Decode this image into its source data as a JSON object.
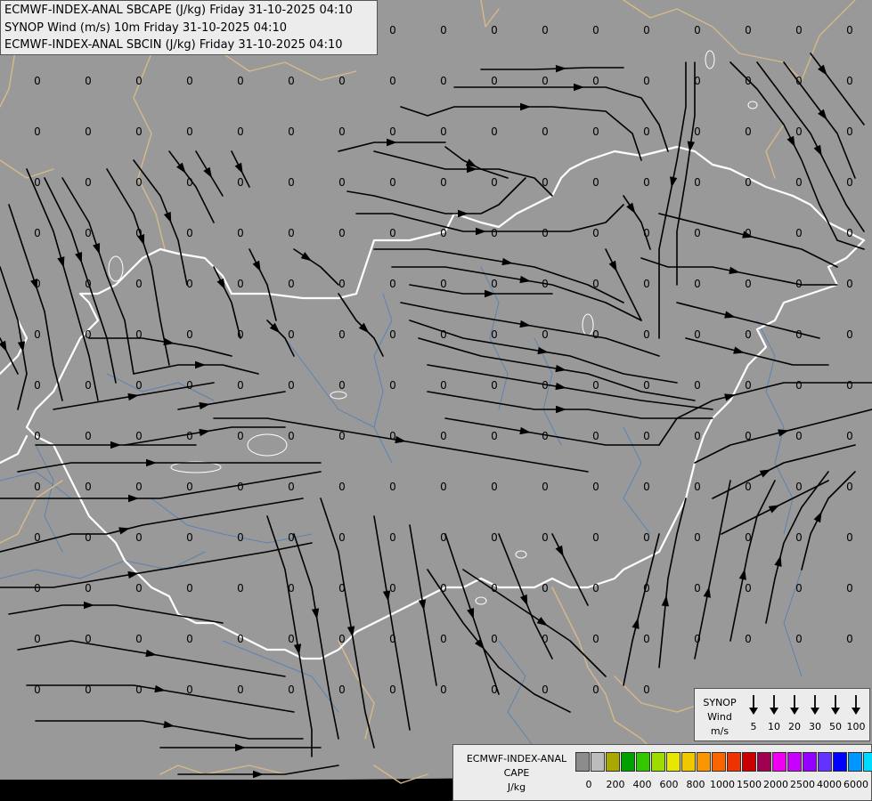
{
  "header": {
    "line1": "ECMWF-INDEX-ANAL SBCAPE (J/kg) Friday 31-10-2025 04:10",
    "line2": "SYNOP Wind (m/s) 10m Friday 31-10-2025 04:10",
    "line3": "ECMWF-INDEX-ANAL SBCIN (J/kg) Friday 31-10-2025 04:10"
  },
  "map": {
    "value_label": "0",
    "colors": {
      "background": "#999999",
      "border_national": "#ffffff",
      "border_regional": "#d6b989",
      "river": "#5c83b0",
      "streamline": "#000000"
    }
  },
  "synop_legend": {
    "title_line1": "SYNOP",
    "title_line2": "Wind",
    "title_line3": "m/s",
    "values": [
      "5",
      "10",
      "20",
      "30",
      "50",
      "100"
    ]
  },
  "cape_legend": {
    "title_line1": "ECMWF-INDEX-ANAL",
    "title_line2": "CAPE",
    "title_line3": "J/kg",
    "swatch_colors": [
      "#8c8c8c",
      "#bcbcbc",
      "#a8a800",
      "#00a000",
      "#32c800",
      "#9cdc00",
      "#e6e600",
      "#f0c800",
      "#fa9600",
      "#fa6400",
      "#f03200",
      "#c80000",
      "#a00050",
      "#f000f0",
      "#c800ff",
      "#9600ff",
      "#6432ff",
      "#0000ff",
      "#0096ff",
      "#00dcff",
      "#00ffff",
      "#ffffff"
    ],
    "ticks": [
      "0",
      "200",
      "400",
      "600",
      "800",
      "1000",
      "1500",
      "2000",
      "2500",
      "4000",
      "6000"
    ]
  }
}
